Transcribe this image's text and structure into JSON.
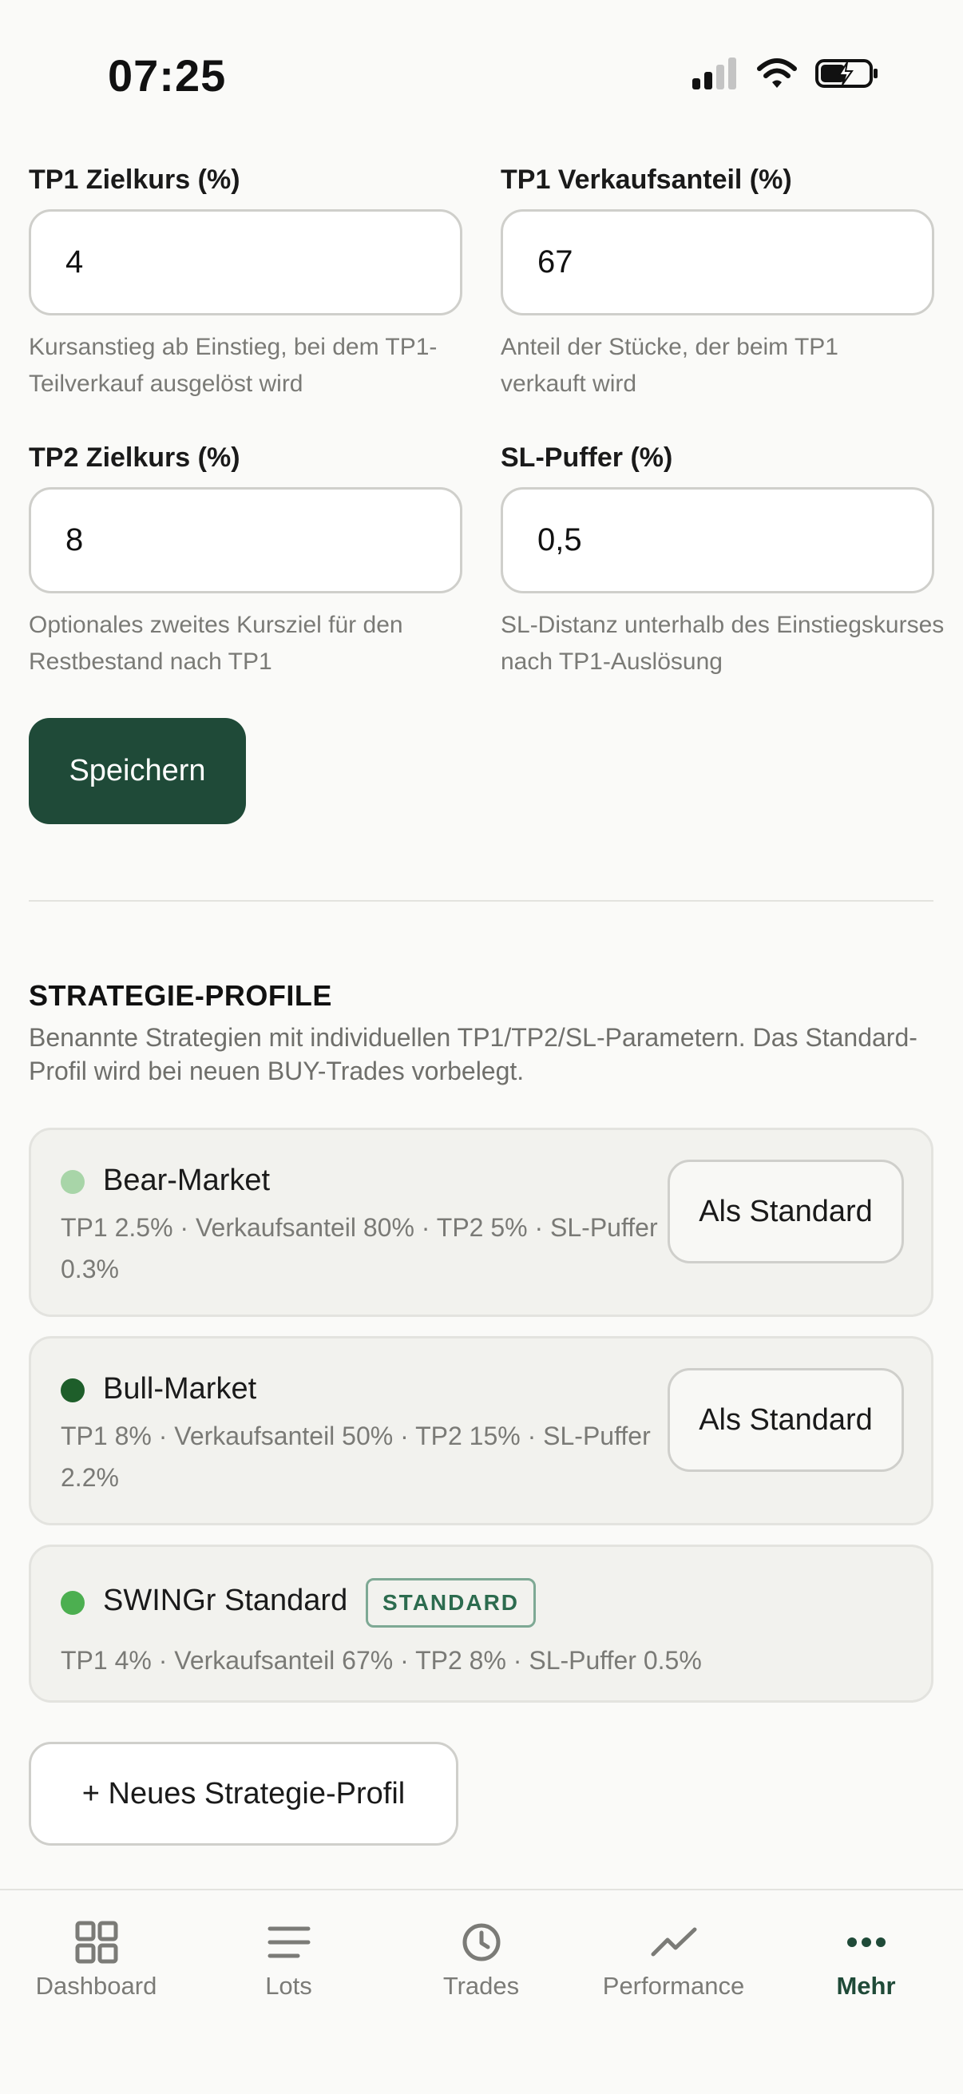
{
  "status": {
    "time": "07:25"
  },
  "settings": {
    "tp1_target": {
      "label": "TP1 Zielkurs (%)",
      "value": "4",
      "hint": "Kursanstieg ab Einstieg, bei dem TP1-Teilverkauf ausgelöst wird"
    },
    "tp1_share": {
      "label": "TP1 Verkaufsanteil (%)",
      "value": "67",
      "hint": "Anteil der Stücke, der beim TP1 verkauft wird"
    },
    "tp2_target": {
      "label": "TP2 Zielkurs (%)",
      "value": "8",
      "hint": "Optionales zweites Kursziel für den Restbestand nach TP1"
    },
    "sl_buffer": {
      "label": "SL-Puffer (%)",
      "value": "0,5",
      "hint": "SL-Distanz unterhalb des Einstiegskurses nach TP1-Auslösung"
    },
    "save_label": "Speichern"
  },
  "profiles": {
    "title": "STRATEGIE-PROFILE",
    "description": "Benannte Strategien mit individuellen TP1/TP2/SL-Parametern. Das Standard-Profil wird bei neuen BUY-Trades vorbelegt.",
    "items": [
      {
        "name": "Bear-Market",
        "details": "TP1 2.5% · Verkaufsanteil 80% · TP2 5% · SL-Puffer 0.3%",
        "dot_color": "#a8d5a8",
        "action_label": "Als Standard"
      },
      {
        "name": "Bull-Market",
        "details": "TP1 8% · Verkaufsanteil 50% · TP2 15% · SL-Puffer 2.2%",
        "dot_color": "#1e5e2a",
        "action_label": "Als Standard"
      },
      {
        "name": "SWINGr Standard",
        "details": "TP1 4% · Verkaufsanteil 67% · TP2 8% · SL-Puffer 0.5%",
        "dot_color": "#4caf50",
        "badge": "STANDARD"
      }
    ],
    "new_label": "+ Neues Strategie-Profil"
  },
  "tabs": [
    {
      "label": "Dashboard",
      "icon": "grid-icon"
    },
    {
      "label": "Lots",
      "icon": "list-icon"
    },
    {
      "label": "Trades",
      "icon": "clock-icon"
    },
    {
      "label": "Performance",
      "icon": "trend-icon"
    },
    {
      "label": "Mehr",
      "icon": "more-icon",
      "active": true
    }
  ],
  "colors": {
    "accent": "#1f4a38",
    "badge": "#2c6b4e"
  }
}
